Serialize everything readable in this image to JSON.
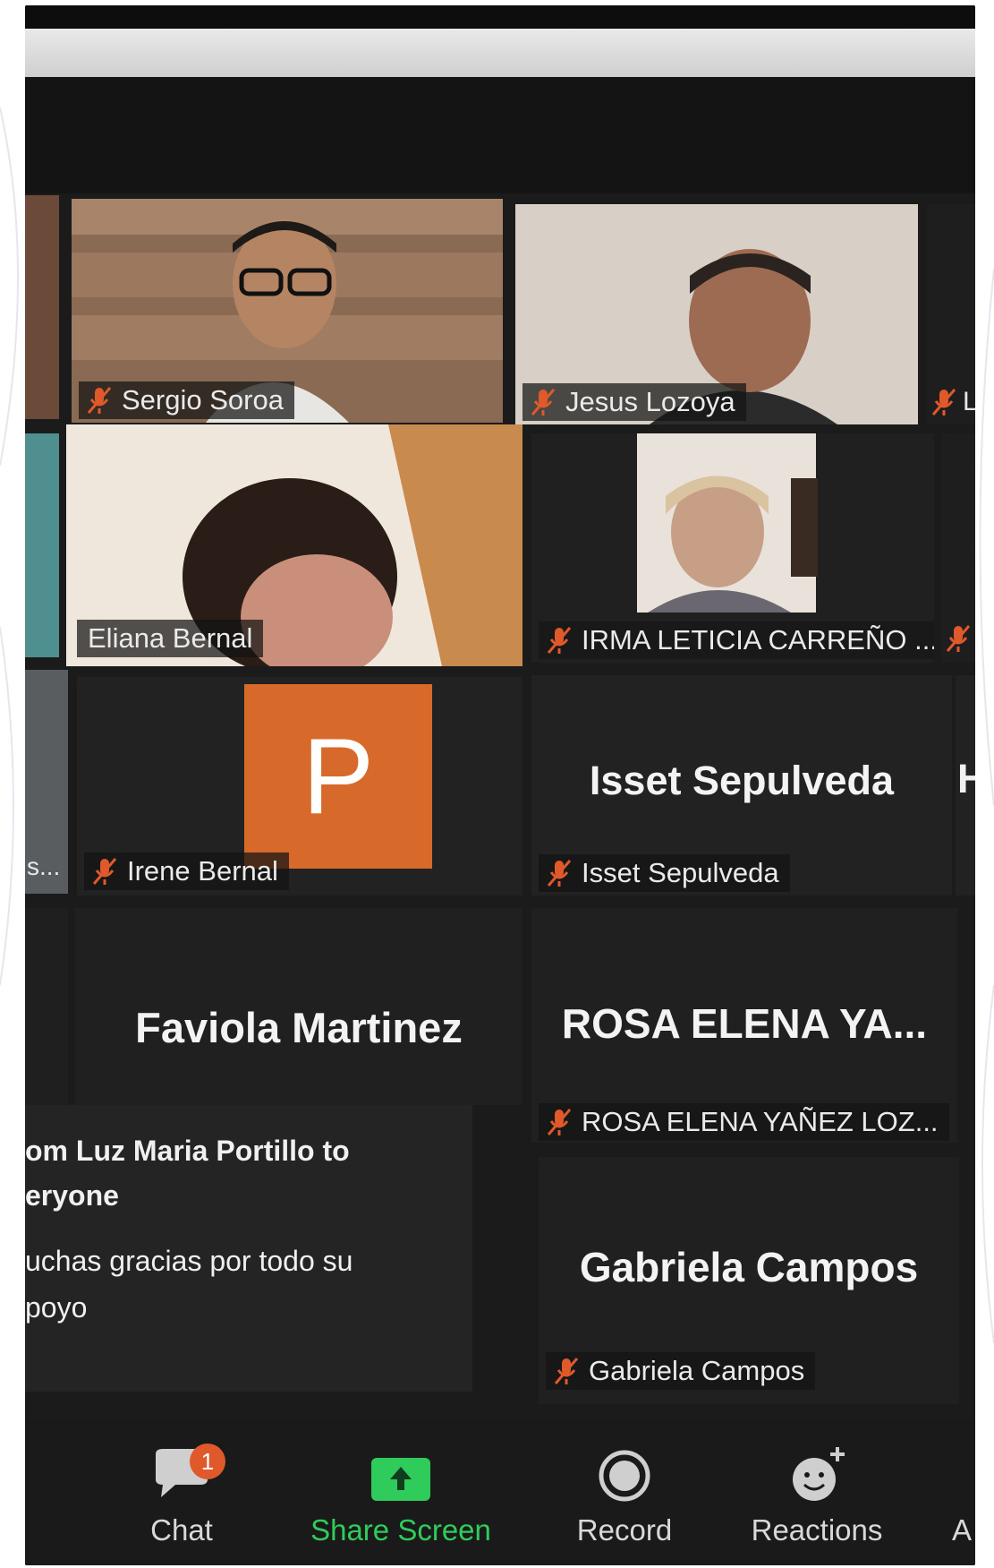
{
  "participants": {
    "sergio": {
      "name": "Sergio Soroa",
      "muted": true
    },
    "jesus": {
      "name": "Jesus Lozoya",
      "muted": true
    },
    "eliana": {
      "name": "Eliana Bernal",
      "muted": false,
      "speaking": true
    },
    "irma": {
      "name": "IRMA LETICIA CARREÑO ...",
      "muted": true
    },
    "irene": {
      "name": "Irene Bernal",
      "muted": true,
      "avatar_letter": "P"
    },
    "isset": {
      "display_name": "Isset Sepulveda",
      "name": "Isset Sepulveda",
      "muted": true
    },
    "faviola": {
      "display_name": "Faviola Martinez"
    },
    "rosa": {
      "display_name": "ROSA ELENA YA...",
      "name": "ROSA ELENA YAÑEZ LOZ...",
      "muted": true
    },
    "gabriela": {
      "display_name": "Gabriela Campos",
      "name": "Gabriela Campos",
      "muted": true
    },
    "edge_left_chip": "s...",
    "edge_right_chip": "L",
    "edge_right_big": "H"
  },
  "chat_notification": {
    "from_line": "om Luz Maria Portillo to\neryone",
    "message": "uchas gracias por todo su\npoyo"
  },
  "toolbar": {
    "chat": {
      "label": "Chat",
      "badge": "1"
    },
    "share": {
      "label": "Share Screen"
    },
    "record": {
      "label": "Record"
    },
    "reactions": {
      "label": "Reactions"
    },
    "apps_partial": {
      "label": "A"
    }
  },
  "colors": {
    "speaker_outline": "#d9e36a",
    "avatar_orange": "#d76a2a",
    "share_green": "#2fcc5c",
    "mute_red": "#e0592b"
  }
}
